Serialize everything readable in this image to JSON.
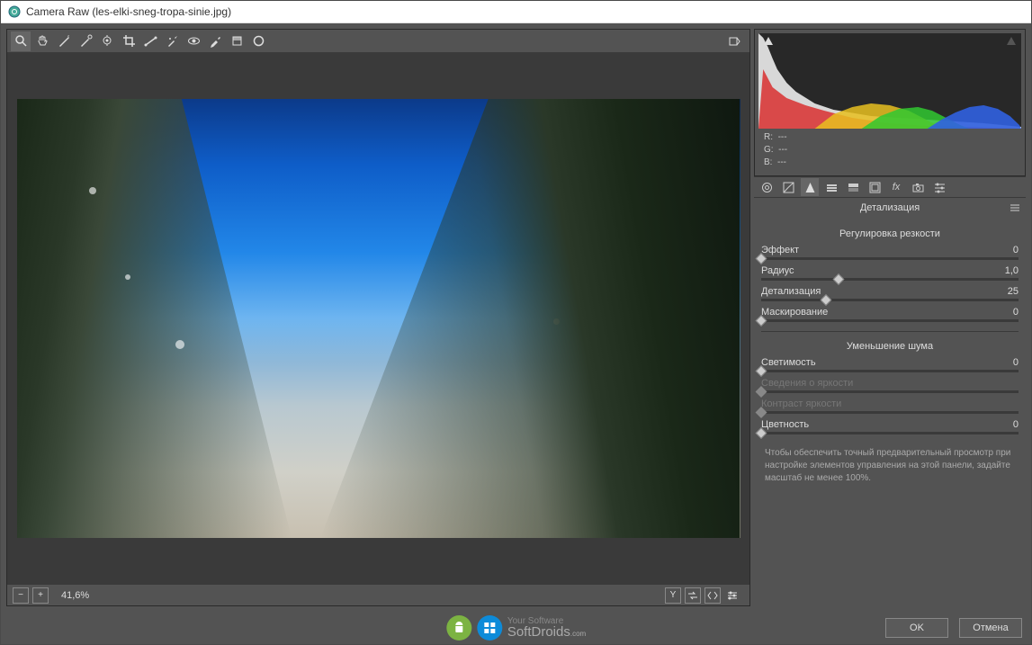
{
  "window": {
    "title": "Camera Raw (les-elki-sneg-tropa-sinie.jpg)"
  },
  "rgb": {
    "r_label": "R:",
    "g_label": "G:",
    "b_label": "B:",
    "dash": "---"
  },
  "status": {
    "zoom": "41,6%"
  },
  "panel": {
    "title": "Детализация",
    "section1": "Регулировка резкости",
    "effect": {
      "label": "Эффект",
      "value": "0",
      "pos": 0
    },
    "radius": {
      "label": "Радиус",
      "value": "1,0",
      "pos": 30
    },
    "detail": {
      "label": "Детализация",
      "value": "25",
      "pos": 25
    },
    "masking": {
      "label": "Маскирование",
      "value": "0",
      "pos": 0
    },
    "section2": "Уменьшение шума",
    "luminance": {
      "label": "Светимость",
      "value": "0",
      "pos": 0
    },
    "lum_detail": {
      "label": "Сведения о яркости",
      "value": "",
      "pos": 0
    },
    "lum_contrast": {
      "label": "Контраст яркости",
      "value": "",
      "pos": 0
    },
    "color": {
      "label": "Цветность",
      "value": "0",
      "pos": 0
    },
    "hint": "Чтобы обеспечить точный предварительный просмотр при настройке элементов управления на этой панели, задайте масштаб не менее 100%."
  },
  "buttons": {
    "ok": "OK",
    "cancel": "Отмена"
  },
  "brand": {
    "small": "Your Software",
    "big": "SoftDroids",
    "suffix": ".com"
  }
}
